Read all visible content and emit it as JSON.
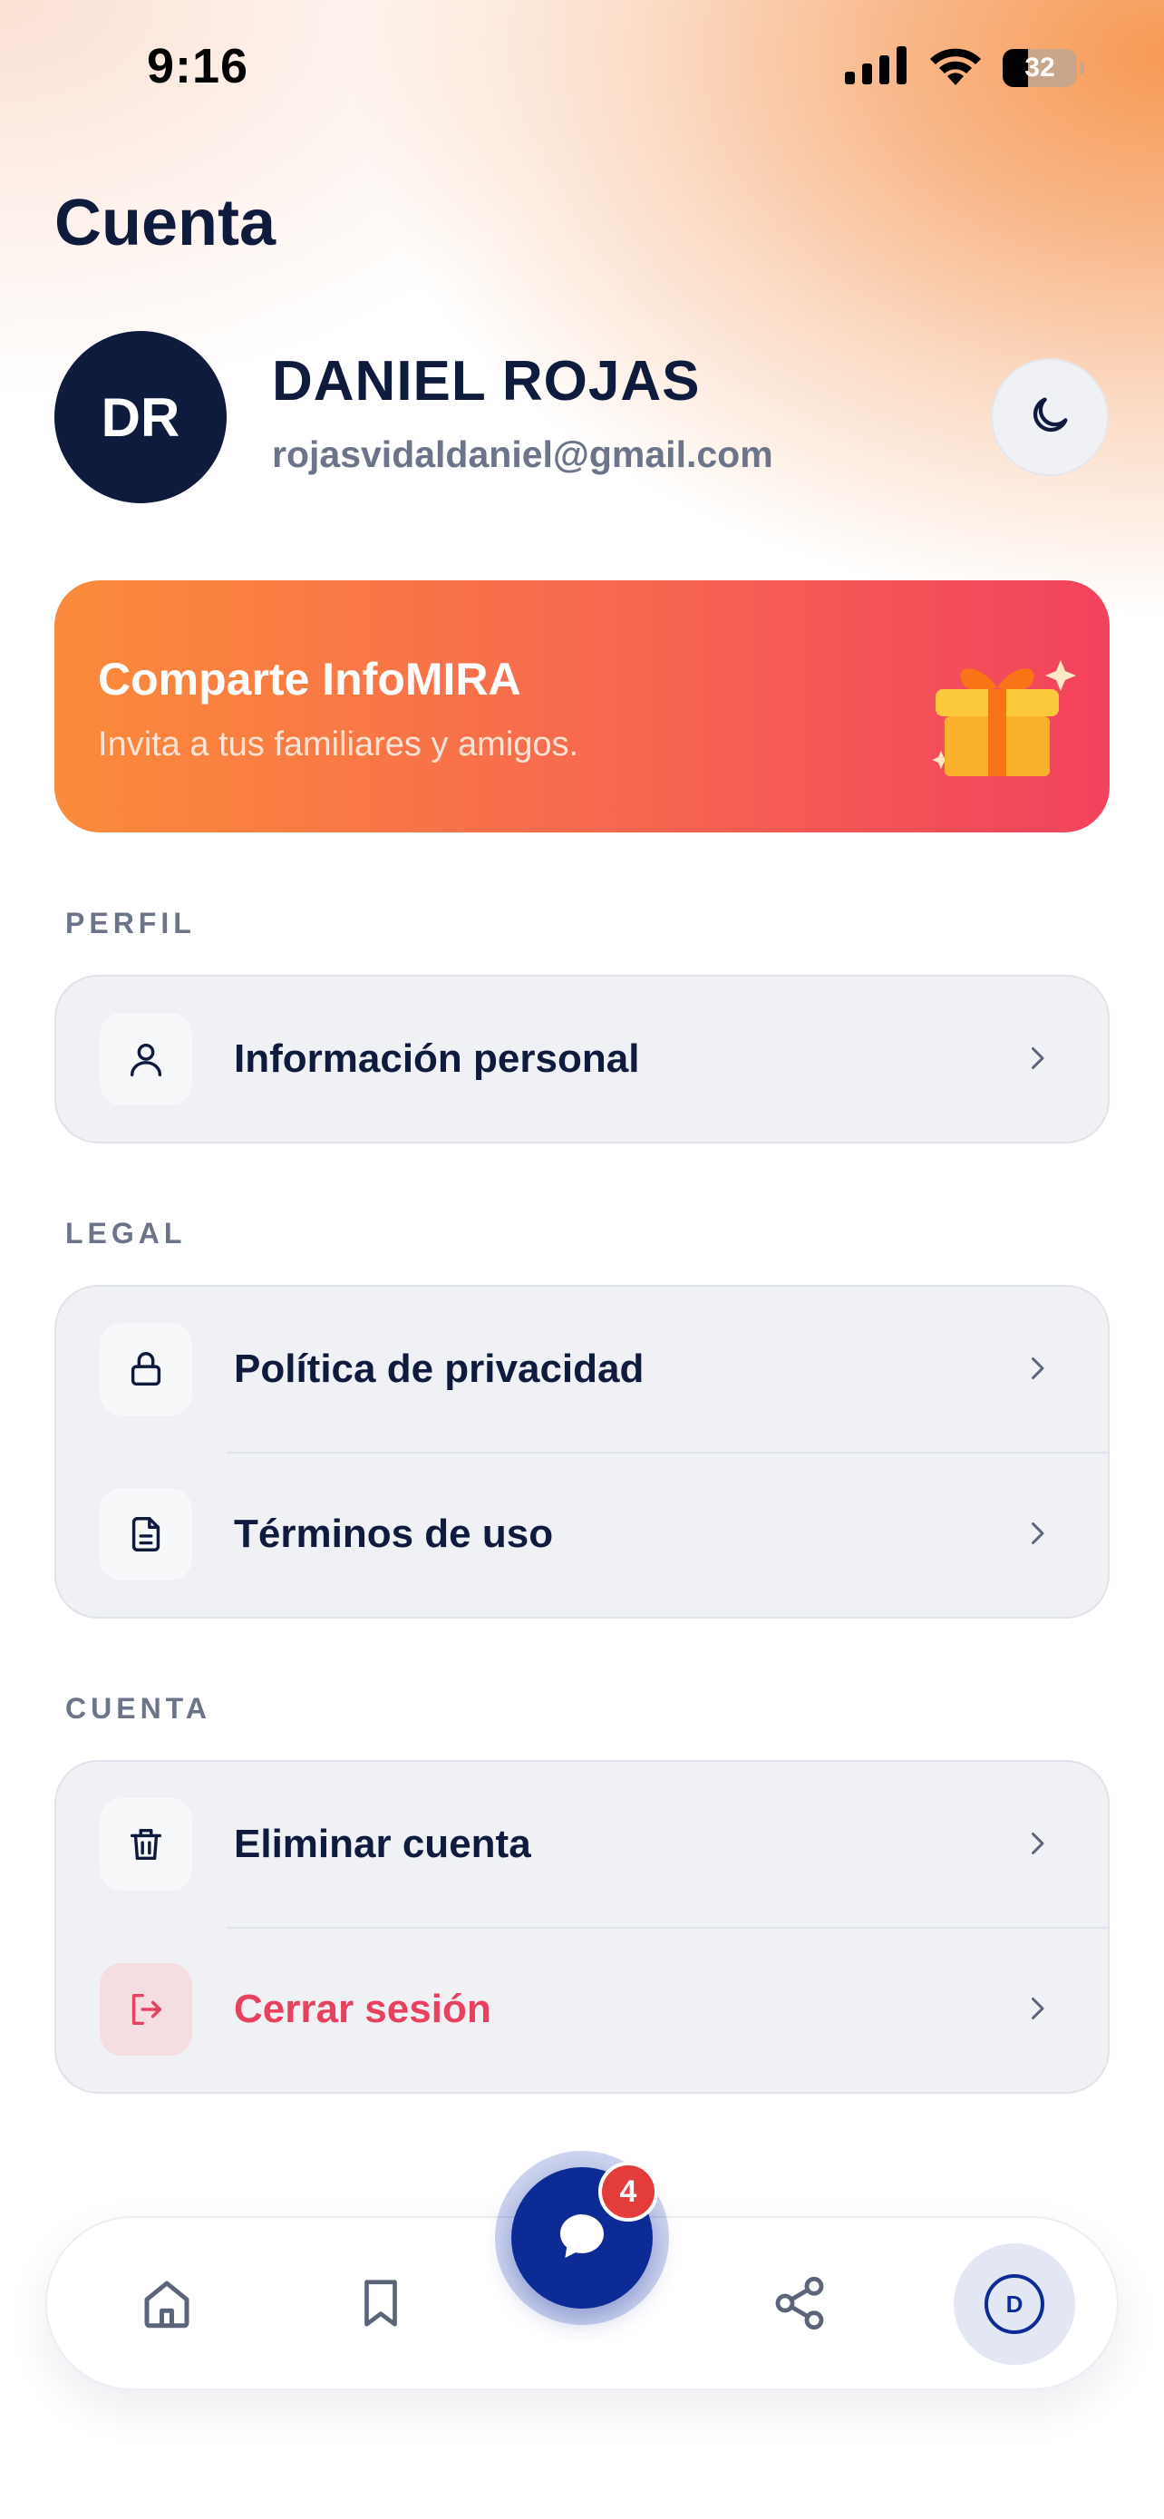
{
  "status_bar": {
    "time": "9:16",
    "battery": "32"
  },
  "header": {
    "title": "Cuenta"
  },
  "profile": {
    "initials": "DR",
    "name": "DANIEL ROJAS",
    "email": "rojasvidaldaniel@gmail.com"
  },
  "promo": {
    "title": "Comparte InfoMIRA",
    "subtitle": "Invita a tus familiares y amigos."
  },
  "sections": {
    "perfil": {
      "label": "PERFIL",
      "items": [
        {
          "label": "Información personal",
          "icon": "user-icon"
        }
      ]
    },
    "legal": {
      "label": "LEGAL",
      "items": [
        {
          "label": "Política de privacidad",
          "icon": "lock-icon"
        },
        {
          "label": "Términos de uso",
          "icon": "document-icon"
        }
      ]
    },
    "cuenta": {
      "label": "CUENTA",
      "items": [
        {
          "label": "Eliminar cuenta",
          "icon": "trash-icon"
        },
        {
          "label": "Cerrar sesión",
          "icon": "logout-icon"
        }
      ]
    }
  },
  "tabbar": {
    "chat_badge": "4",
    "profile_initial": "D",
    "items": [
      "home-icon",
      "bookmark-icon",
      "chat-icon",
      "share-icon",
      "profile-avatar"
    ]
  },
  "colors": {
    "primary": "#0d2b94",
    "navy_text": "#0f1b3d",
    "danger": "#e8405f",
    "promo_start": "#fb8b3a",
    "promo_end": "#f2425e",
    "badge": "#e43b3b"
  }
}
